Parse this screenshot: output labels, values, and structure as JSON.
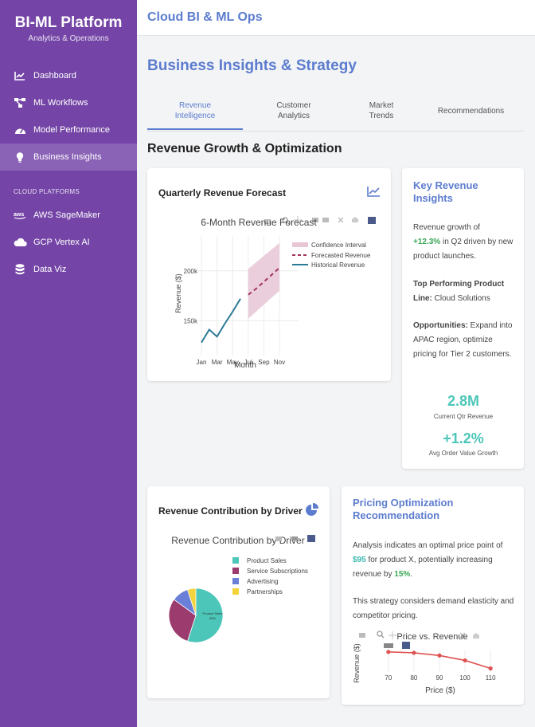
{
  "sidebar": {
    "brand": "BI-ML Platform",
    "subtitle": "Analytics & Operations",
    "items": [
      {
        "label": "Dashboard"
      },
      {
        "label": "ML Workflows"
      },
      {
        "label": "Model Performance"
      },
      {
        "label": "Business Insights"
      }
    ],
    "section_label": "CLOUD PLATFORMS",
    "cloud_items": [
      {
        "label": "AWS SageMaker"
      },
      {
        "label": "GCP Vertex AI"
      },
      {
        "label": "Data Viz"
      }
    ]
  },
  "header": {
    "title": "Cloud BI & ML Ops"
  },
  "page": {
    "title": "Business Insights & Strategy",
    "section_title": "Revenue Growth & Optimization"
  },
  "tabs": [
    {
      "line1": "Revenue",
      "line2": "Intelligence"
    },
    {
      "line1": "Customer",
      "line2": "Analytics"
    },
    {
      "line1": "Market",
      "line2": "Trends"
    },
    {
      "line1": "Recommendations",
      "line2": ""
    }
  ],
  "forecast_card": {
    "title": "Quarterly Revenue Forecast"
  },
  "insights": {
    "title_line1": "Key Revenue",
    "title_line2": "Insights",
    "growth_prefix": "Revenue growth of",
    "growth_value": "+12.3%",
    "growth_suffix": "in Q2 driven by new product launches.",
    "top_label": "Top Performing Product Line:",
    "top_value": "Cloud Solutions",
    "opp_label": "Opportunities:",
    "opp_text": "Expand into APAC region, optimize pricing for Tier 2 customers.",
    "metric1_value": "2.8M",
    "metric1_label": "Current Qtr Revenue",
    "metric2_value": "+1.2%",
    "metric2_label": "Avg Order Value Growth"
  },
  "contribution_card": {
    "title": "Revenue Contribution by Driver"
  },
  "pricing": {
    "title_line1": "Pricing Optimization",
    "title_line2": "Recommendation",
    "p1_prefix": "Analysis indicates an optimal price point of",
    "p1_price": "$95",
    "p1_mid": "for product X, potentially increasing revenue by",
    "p1_pct": "15%",
    "p1_end": ".",
    "p2": "This strategy considers demand elasticity and competitor pricing."
  },
  "colors": {
    "sidebar": "#7445a6",
    "accent_blue": "#5c7cce",
    "teal": "#4cc6b8",
    "positive": "#3aa655"
  },
  "chart_data": [
    {
      "type": "line",
      "title": "6-Month Revenue Forecast",
      "xlabel": "Month",
      "ylabel": "Revenue ($)",
      "categories": [
        "Jan",
        "Feb",
        "Mar",
        "Apr",
        "May",
        "Jun",
        "Jul",
        "Aug",
        "Sep",
        "Oct",
        "Nov"
      ],
      "tick_labels": [
        "Jan",
        "Mar",
        "May",
        "Jul",
        "Sep",
        "Nov"
      ],
      "y_ticks": [
        {
          "value": 150000,
          "label": "150k"
        },
        {
          "value": 200000,
          "label": "200k"
        }
      ],
      "ylim": [
        115000,
        235000
      ],
      "series": [
        {
          "name": "Historical Revenue",
          "x": [
            "Jan",
            "Feb",
            "Mar",
            "Apr",
            "May",
            "Jun"
          ],
          "values": [
            128000,
            141000,
            134000,
            147000,
            159000,
            172000
          ]
        },
        {
          "name": "Forecasted Revenue",
          "x": [
            "Jul",
            "Aug",
            "Sep",
            "Oct",
            "Nov"
          ],
          "values": [
            176000,
            182000,
            189000,
            196000,
            203000
          ]
        }
      ],
      "band": {
        "name": "Confidence Interval",
        "x": [
          "Jul",
          "Nov"
        ],
        "lower": [
          152000,
          180000
        ],
        "upper": [
          202000,
          228000
        ]
      },
      "legend": "top-right",
      "grid": true
    },
    {
      "type": "pie",
      "title": "Revenue Contribution by Driver",
      "slices": [
        {
          "label": "Product Sales",
          "value": 55,
          "color": "#4cc6b8"
        },
        {
          "label": "Service Subscriptions",
          "value": 30,
          "color": "#9b3b6e"
        },
        {
          "label": "Advertising",
          "value": 10,
          "color": "#6a7fd8"
        },
        {
          "label": "Partnerships",
          "value": 5,
          "color": "#f5d33a"
        }
      ],
      "legend": "right"
    },
    {
      "type": "line",
      "title": "Price vs. Revenue",
      "xlabel": "Price ($)",
      "ylabel": "Revenue ($)",
      "x": [
        70,
        80,
        90,
        100,
        110
      ],
      "values": [
        11500,
        11300,
        10700,
        9600,
        7800
      ],
      "xlim": [
        66,
        114
      ],
      "ylim": [
        7000,
        12000
      ],
      "color": "#e05252",
      "grid": true
    }
  ]
}
